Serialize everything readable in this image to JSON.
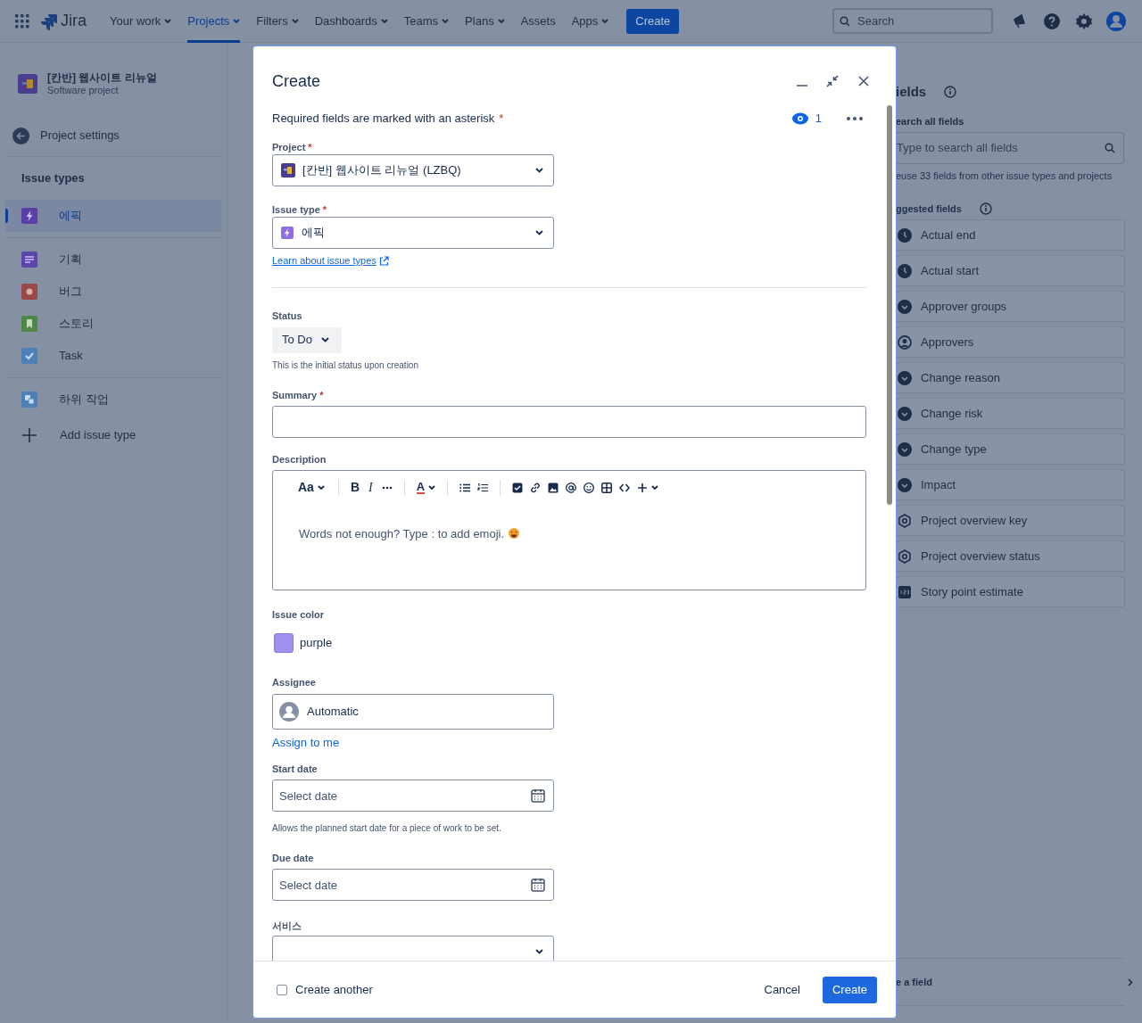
{
  "nav": {
    "product": "Jira",
    "items": [
      {
        "label": "Your work",
        "selected": false,
        "dropdown": true
      },
      {
        "label": "Projects",
        "selected": true,
        "dropdown": true
      },
      {
        "label": "Filters",
        "selected": false,
        "dropdown": true
      },
      {
        "label": "Dashboards",
        "selected": false,
        "dropdown": true
      },
      {
        "label": "Teams",
        "selected": false,
        "dropdown": true
      },
      {
        "label": "Plans",
        "selected": false,
        "dropdown": true
      },
      {
        "label": "Assets",
        "selected": false,
        "dropdown": false
      },
      {
        "label": "Apps",
        "selected": false,
        "dropdown": true
      }
    ],
    "create": "Create",
    "search": {
      "placeholder": "Search"
    }
  },
  "sidebar": {
    "project": {
      "name": "[칸반] 웹사이트 리뉴얼",
      "type": "Software project"
    },
    "back_link": "Project settings",
    "section_title": "Issue types",
    "groups": [
      [
        {
          "label": "에픽",
          "kind": "epic",
          "color": "#5b3fa6",
          "selected": true
        }
      ],
      [
        {
          "label": "기획",
          "kind": "plan",
          "color": "#5c46ab",
          "selected": false
        },
        {
          "label": "버그",
          "kind": "bug",
          "color": "#9b4848",
          "selected": false
        },
        {
          "label": "스토리",
          "kind": "story",
          "color": "#4f8749",
          "selected": false
        },
        {
          "label": "Task",
          "kind": "task",
          "color": "#4d80b6",
          "selected": false
        }
      ],
      [
        {
          "label": "하위 작업",
          "kind": "subtask",
          "color": "#4d80b6",
          "selected": false
        }
      ]
    ],
    "add_type": "Add issue type"
  },
  "fields_panel": {
    "title": "ields",
    "search_label": "earch all fields",
    "search_placeholder": "Type to search all fields",
    "hint": "euse 33 fields from other issue types and projects",
    "suggested_label": "ggested fields",
    "fields": [
      {
        "label": "Actual end",
        "kind": "clock"
      },
      {
        "label": "Actual start",
        "kind": "clock"
      },
      {
        "label": "Approver groups",
        "kind": "select"
      },
      {
        "label": "Approvers",
        "kind": "user"
      },
      {
        "label": "Change reason",
        "kind": "select"
      },
      {
        "label": "Change risk",
        "kind": "select"
      },
      {
        "label": "Change type",
        "kind": "select"
      },
      {
        "label": "Impact",
        "kind": "select"
      },
      {
        "label": "Project overview key",
        "kind": "gear"
      },
      {
        "label": "Project overview status",
        "kind": "gear"
      },
      {
        "label": "Story point estimate",
        "kind": "number"
      }
    ],
    "footer_link": "e a field"
  },
  "modal": {
    "title": "Create",
    "required_note": "Required fields are marked with an asterisk",
    "required_mark": "*",
    "watchers": "1",
    "project": {
      "label": "Project",
      "required_mark": "*",
      "value": "[칸반] 웹사이트 리뉴얼 (LZBQ)"
    },
    "issue_type": {
      "label": "Issue type",
      "required_mark": "*",
      "value": "에픽",
      "link": "Learn about issue types"
    },
    "status": {
      "label": "Status",
      "value": "To Do",
      "help": "This is the initial status upon creation"
    },
    "summary": {
      "label": "Summary",
      "required_mark": "*"
    },
    "description": {
      "label": "Description",
      "placeholder": "Words not enough? Type : to add emoji.",
      "toolbar": [
        {
          "kind": "text-style",
          "label": "Aa"
        },
        {
          "kind": "divider"
        },
        {
          "kind": "bold",
          "label": "B"
        },
        {
          "kind": "italic",
          "label": "I"
        },
        {
          "kind": "more"
        },
        {
          "kind": "divider"
        },
        {
          "kind": "text-color",
          "label": "A"
        },
        {
          "kind": "divider"
        },
        {
          "kind": "bullet-list"
        },
        {
          "kind": "numbered-list"
        },
        {
          "kind": "divider"
        },
        {
          "kind": "task"
        },
        {
          "kind": "link"
        },
        {
          "kind": "image"
        },
        {
          "kind": "mention"
        },
        {
          "kind": "emoji"
        },
        {
          "kind": "table"
        },
        {
          "kind": "code"
        },
        {
          "kind": "insert"
        }
      ]
    },
    "issue_color": {
      "label": "Issue color",
      "value": "purple",
      "color": "#9f8fef"
    },
    "assignee": {
      "label": "Assignee",
      "value": "Automatic",
      "link": "Assign to me"
    },
    "start_date": {
      "label": "Start date",
      "placeholder": "Select date",
      "help": "Allows the planned start date for a piece of work to be set."
    },
    "due_date": {
      "label": "Due date",
      "placeholder": "Select date"
    },
    "service": {
      "label": "서비스"
    },
    "footer": {
      "create_another": {
        "label": "Create another",
        "checked": false
      },
      "cancel": "Cancel",
      "create": "Create"
    }
  }
}
